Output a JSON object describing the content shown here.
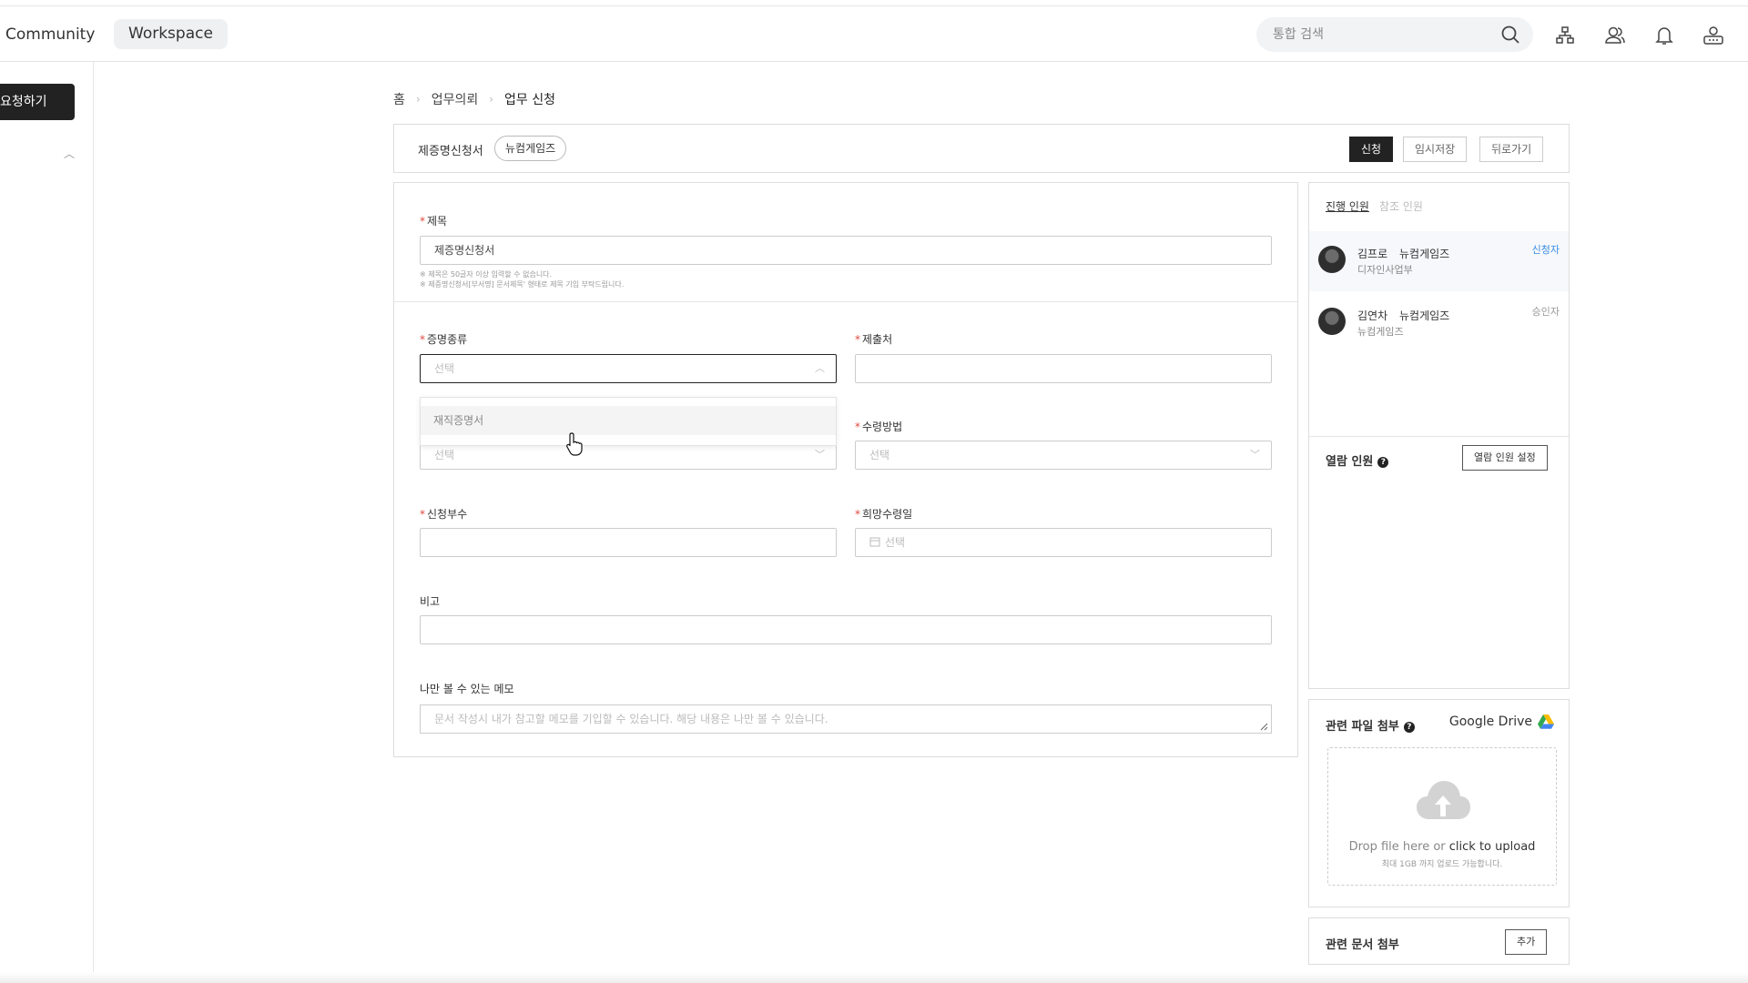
{
  "nav": {
    "community": "Community",
    "workspace": "Workspace"
  },
  "search": {
    "placeholder": "통합 검색"
  },
  "sidebar": {
    "primary_button": "요청하기"
  },
  "breadcrumb": [
    "홈",
    "업무의뢰",
    "업무 신청"
  ],
  "header": {
    "doc_title": "제증명신청서",
    "tag": "뉴컴게임즈",
    "submit": "신청",
    "save_draft": "임시저장",
    "back": "뒤로가기"
  },
  "form": {
    "title_label": "제목",
    "title_value": "제증명신청서",
    "title_hints": [
      "※ 제목은 50글자 이상 입력할 수 없습니다.",
      "※ 제증명신청서[부서명] 문서제목' 형태로 제목 기입 부탁드립니다."
    ],
    "cert_type_label": "증명종류",
    "cert_type_placeholder": "선택",
    "dropdown_options": [
      "재직증명서"
    ],
    "submit_to_label": "제출처",
    "purpose_placeholder": "선택",
    "receive_method_label": "수령방법",
    "receive_method_placeholder": "선택",
    "copies_label": "신청부수",
    "desired_date_label": "희망수령일",
    "desired_date_placeholder": "선택",
    "remarks_label": "비고",
    "memo_label": "나만 볼 수 있는 메모",
    "memo_placeholder": "문서 작성시 내가 참고할 메모를 기입할 수 있습니다. 해당 내용은 나만 볼 수 있습니다."
  },
  "people": {
    "tab_progress": "진행 인원",
    "tab_reference": "참조 인원",
    "list": [
      {
        "name": "김프로",
        "company": "뉴컴게임즈",
        "dept": "디자인사업부",
        "role": "신청자",
        "role_color": "#3a8ee6"
      },
      {
        "name": "김연차",
        "company": "뉴컴게임즈",
        "dept": "뉴컴게임즈",
        "role": "승인자",
        "role_color": "#999999"
      }
    ],
    "viewer_label": "열람 인원",
    "viewer_button": "열람 인원 설정"
  },
  "attachments": {
    "title": "관련 파일 첨부",
    "drive": "Google Drive",
    "drop_text": "Drop file here or ",
    "drop_link": "click to upload",
    "limit_text": "최대 1GB 까지 업로드 가능합니다."
  },
  "related_docs": {
    "title": "관련 문서 첨부",
    "add_button": "추가"
  },
  "icons": [
    "search-icon",
    "org-chart-icon",
    "people-icon",
    "bell-icon",
    "user-icon",
    "chevron-up-icon",
    "chevron-down-icon",
    "calendar-icon",
    "help-icon",
    "google-drive-icon",
    "cloud-upload-icon",
    "hand-cursor-icon",
    "resize-grip-icon"
  ],
  "colors": {
    "primary": "#222222",
    "required": "#e04a3f",
    "link": "#3a8ee6"
  }
}
